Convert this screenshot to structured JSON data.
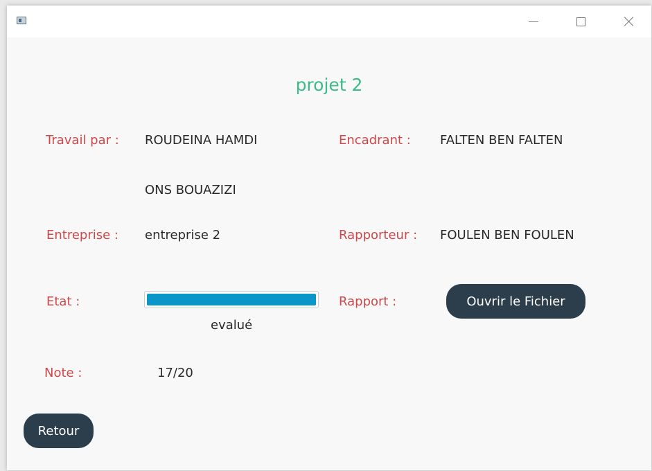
{
  "window": {
    "controls": {
      "minimize": "minimize-icon",
      "maximize": "maximize-icon",
      "close": "close-icon"
    }
  },
  "title": "projet 2",
  "fields": {
    "travail_label": "Travail par :",
    "travail_values": [
      "ROUDEINA HAMDI",
      "ONS BOUAZIZI"
    ],
    "encadrant_label": "Encadrant :",
    "encadrant_value": "FALTEN BEN FALTEN",
    "entreprise_label": "Entreprise :",
    "entreprise_value": "entreprise 2",
    "rapporteur_label": "Rapporteur :",
    "rapporteur_value": "FOULEN BEN FOULEN",
    "etat_label": "Etat :",
    "etat_progress": 1.0,
    "etat_status": "evalué",
    "rapport_label": "Rapport :",
    "note_label": "Note :",
    "note_value": "17/20"
  },
  "buttons": {
    "open_file": "Ouvrir le Fichier",
    "back": "Retour"
  },
  "colors": {
    "title": "#3dbb8a",
    "label": "#d0474a",
    "progress": "#0a96c8",
    "button": "#2c3e4c"
  }
}
